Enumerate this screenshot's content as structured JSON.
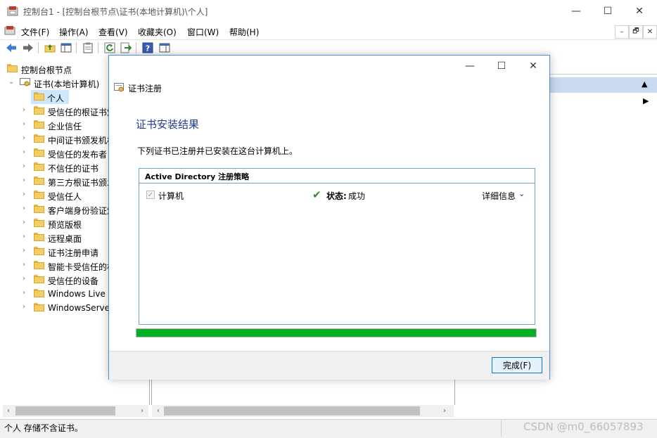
{
  "window": {
    "title": "控制台1 - [控制台根节点\\证书(本地计算机)\\个人]",
    "caption": {
      "minimize": "—",
      "maximize": "☐",
      "close": "✕"
    }
  },
  "menu": {
    "items": [
      "文件(F)",
      "操作(A)",
      "查看(V)",
      "收藏夹(O)",
      "窗口(W)",
      "帮助(H)"
    ],
    "mdi": {
      "minimize": "–",
      "restore": "🗗",
      "close": "✕"
    }
  },
  "toolbar": {
    "icons": [
      "back-icon",
      "forward-icon",
      "up-folder-icon",
      "show-hide-tree-icon",
      "properties-icon",
      "refresh-icon",
      "export-list-icon",
      "help-icon",
      "show-hide-action-icon"
    ]
  },
  "tree": {
    "root": "控制台根节点",
    "store": "证书(本地计算机)",
    "selected": "个人",
    "children": [
      "受信任的根证书颁",
      "企业信任",
      "中间证书颁发机构",
      "受信任的发布者",
      "不信任的证书",
      "第三方根证书颁发",
      "受信任人",
      "客户端身份验证颁",
      "预览版根",
      "远程桌面",
      "证书注册申请",
      "智能卡受信任的根",
      "受信任的设备",
      "Windows Live ID",
      "WindowsServerUpd"
    ]
  },
  "status_bar": {
    "text": "个人 存储不含证书。",
    "watermark": "CSDN @m0_66057893"
  },
  "dialog": {
    "title": "证书注册",
    "heading": "证书安装结果",
    "description": "下列证书已注册并已安装在这台计算机上。",
    "policy": {
      "name": "Active Directory 注册策略",
      "item_label": "计算机",
      "item_checked": true,
      "status_label": "状态:",
      "status_value": "成功",
      "details_label": "详细信息"
    },
    "progress_fraction": 1.0,
    "finish_button": "完成(F)",
    "colors": {
      "heading": "#1f3c88",
      "progress": "#06b025",
      "success": "#2a8a2a"
    }
  }
}
